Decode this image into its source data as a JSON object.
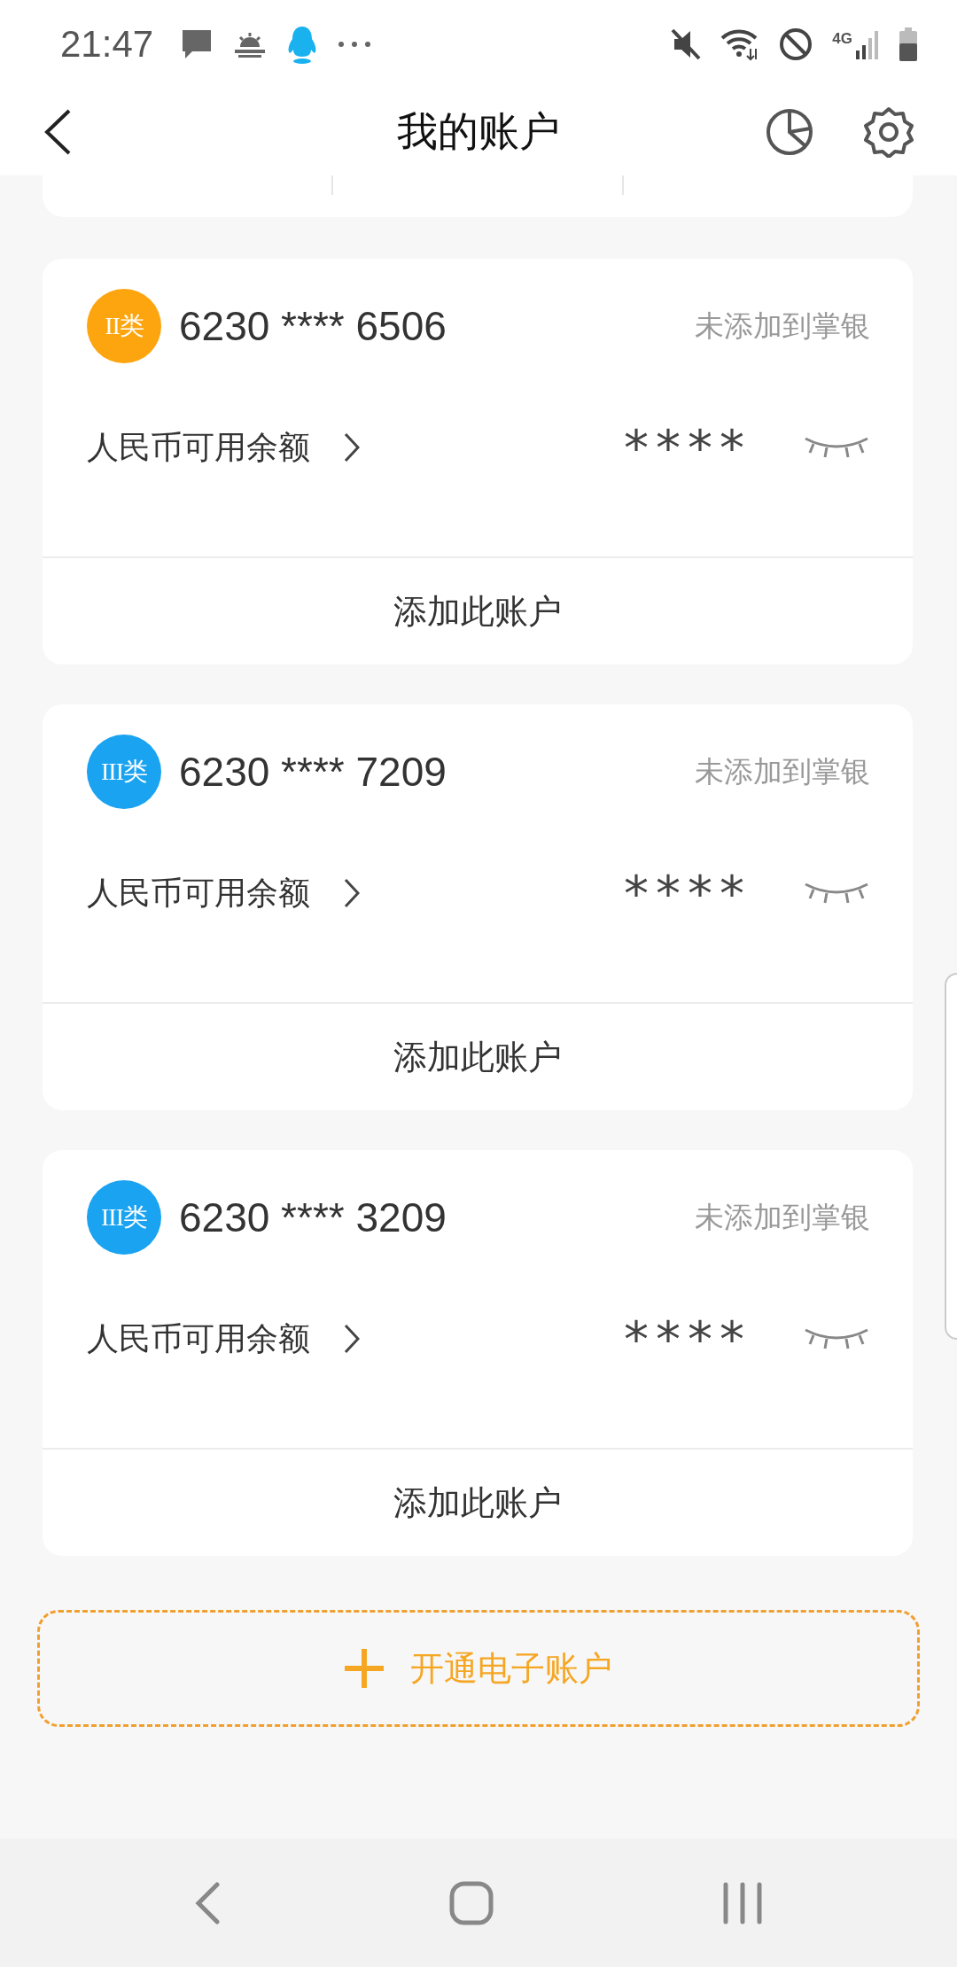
{
  "status_bar": {
    "time": "21:47",
    "network": "4G"
  },
  "header": {
    "title": "我的账户"
  },
  "accounts": [
    {
      "badge": "II类",
      "color": "#fda50f",
      "number": "6230 **** 6506",
      "status": "未添加到掌银",
      "balance_label": "人民币可用余额",
      "balance": "****",
      "action": "添加此账户"
    },
    {
      "badge": "III类",
      "color": "#1aa3f0",
      "number": "6230 **** 7209",
      "status": "未添加到掌银",
      "balance_label": "人民币可用余额",
      "balance": "****",
      "action": "添加此账户"
    },
    {
      "badge": "III类",
      "color": "#1aa3f0",
      "number": "6230 **** 3209",
      "status": "未添加到掌银",
      "balance_label": "人民币可用余额",
      "balance": "****",
      "action": "添加此账户"
    }
  ],
  "open_button": {
    "label": "开通电子账户"
  }
}
